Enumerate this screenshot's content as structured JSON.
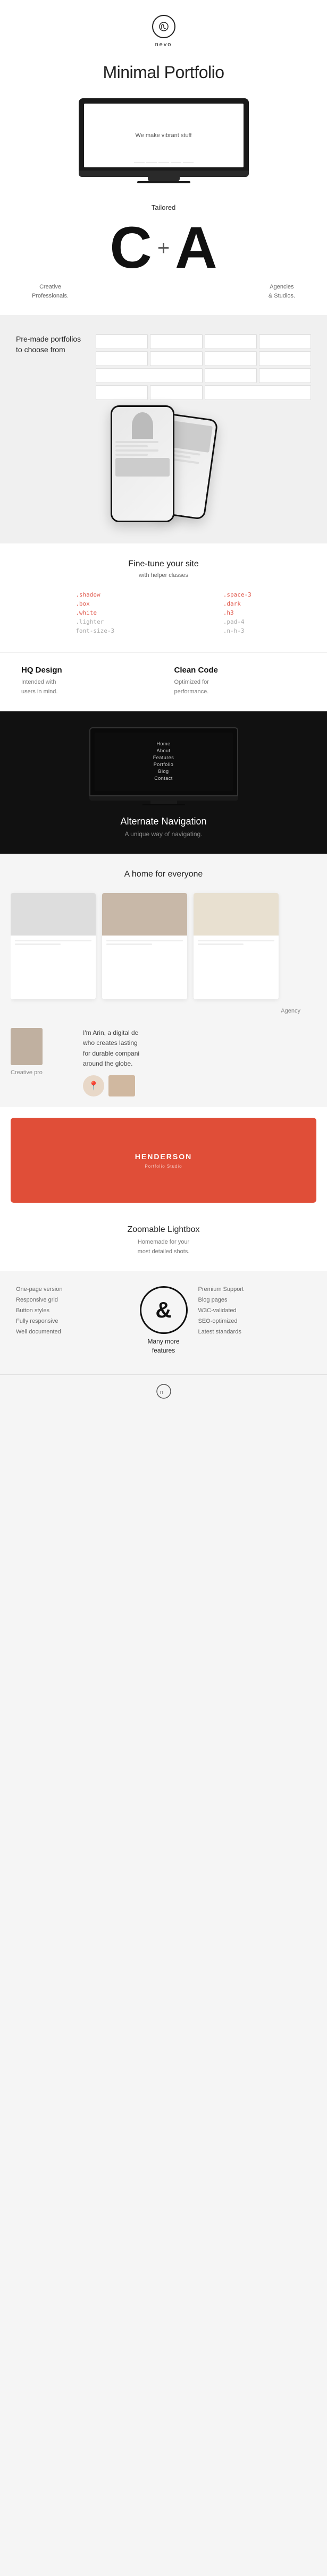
{
  "logo": {
    "text": "nevo",
    "circle_label": "○"
  },
  "header": {
    "title": "Minimal Portfolio"
  },
  "laptop_screen": {
    "text": "We make vibrant stuff"
  },
  "tailored": {
    "label": "Tailored",
    "letter_c": "C",
    "plus": "+",
    "letter_a": "A",
    "left_label": "Creative\nProfessionals.",
    "right_label": "Agencies\n& Studios."
  },
  "premade": {
    "title": "Pre-made portfolios to choose from"
  },
  "helper": {
    "title": "Fine-tune your site",
    "subtitle": "with helper classes",
    "col1": [
      ".shadow",
      ".box",
      ".white",
      ".lighter",
      "font-size-3"
    ],
    "col2": [
      ".space-3",
      ".dark",
      ".h3",
      ".pad-4",
      ".n-h-3"
    ]
  },
  "hq": {
    "title1": "HQ Design",
    "desc1": "Intended with\nusers in mind.",
    "title2": "Clean Code",
    "desc2": "Optimized for\nperformance."
  },
  "dark_nav": {
    "title": "Alternate Navigation",
    "desc": "A unique way of navigating.",
    "nav_items": [
      "Home",
      "About",
      "Features",
      "Portfolio",
      "Blog",
      "Contact"
    ]
  },
  "everyone": {
    "title": "A home for everyone",
    "agency_label": "Agency"
  },
  "creative": {
    "label": "Creative pro",
    "text": "I'm Arin, a digital de\nwho creates lasting \nfor durable compani\naround the globe."
  },
  "red_portfolio": {
    "title": "HENDERSON",
    "subtitle": "Portfolio Studio"
  },
  "lightbox": {
    "title": "Zoomable Lightbox",
    "desc": "Homemade for your\nmost detailed shots."
  },
  "features": {
    "left": [
      "One-page version",
      "Responsive grid",
      "Button styles",
      "Fully responsive",
      "Well documented"
    ],
    "right": [
      "Premium Support",
      "Blog pages",
      "W3C-validated",
      "SEO-optimized",
      "Latest standards"
    ],
    "center_symbol": "&",
    "more_label": "Many more\nfeatures"
  }
}
